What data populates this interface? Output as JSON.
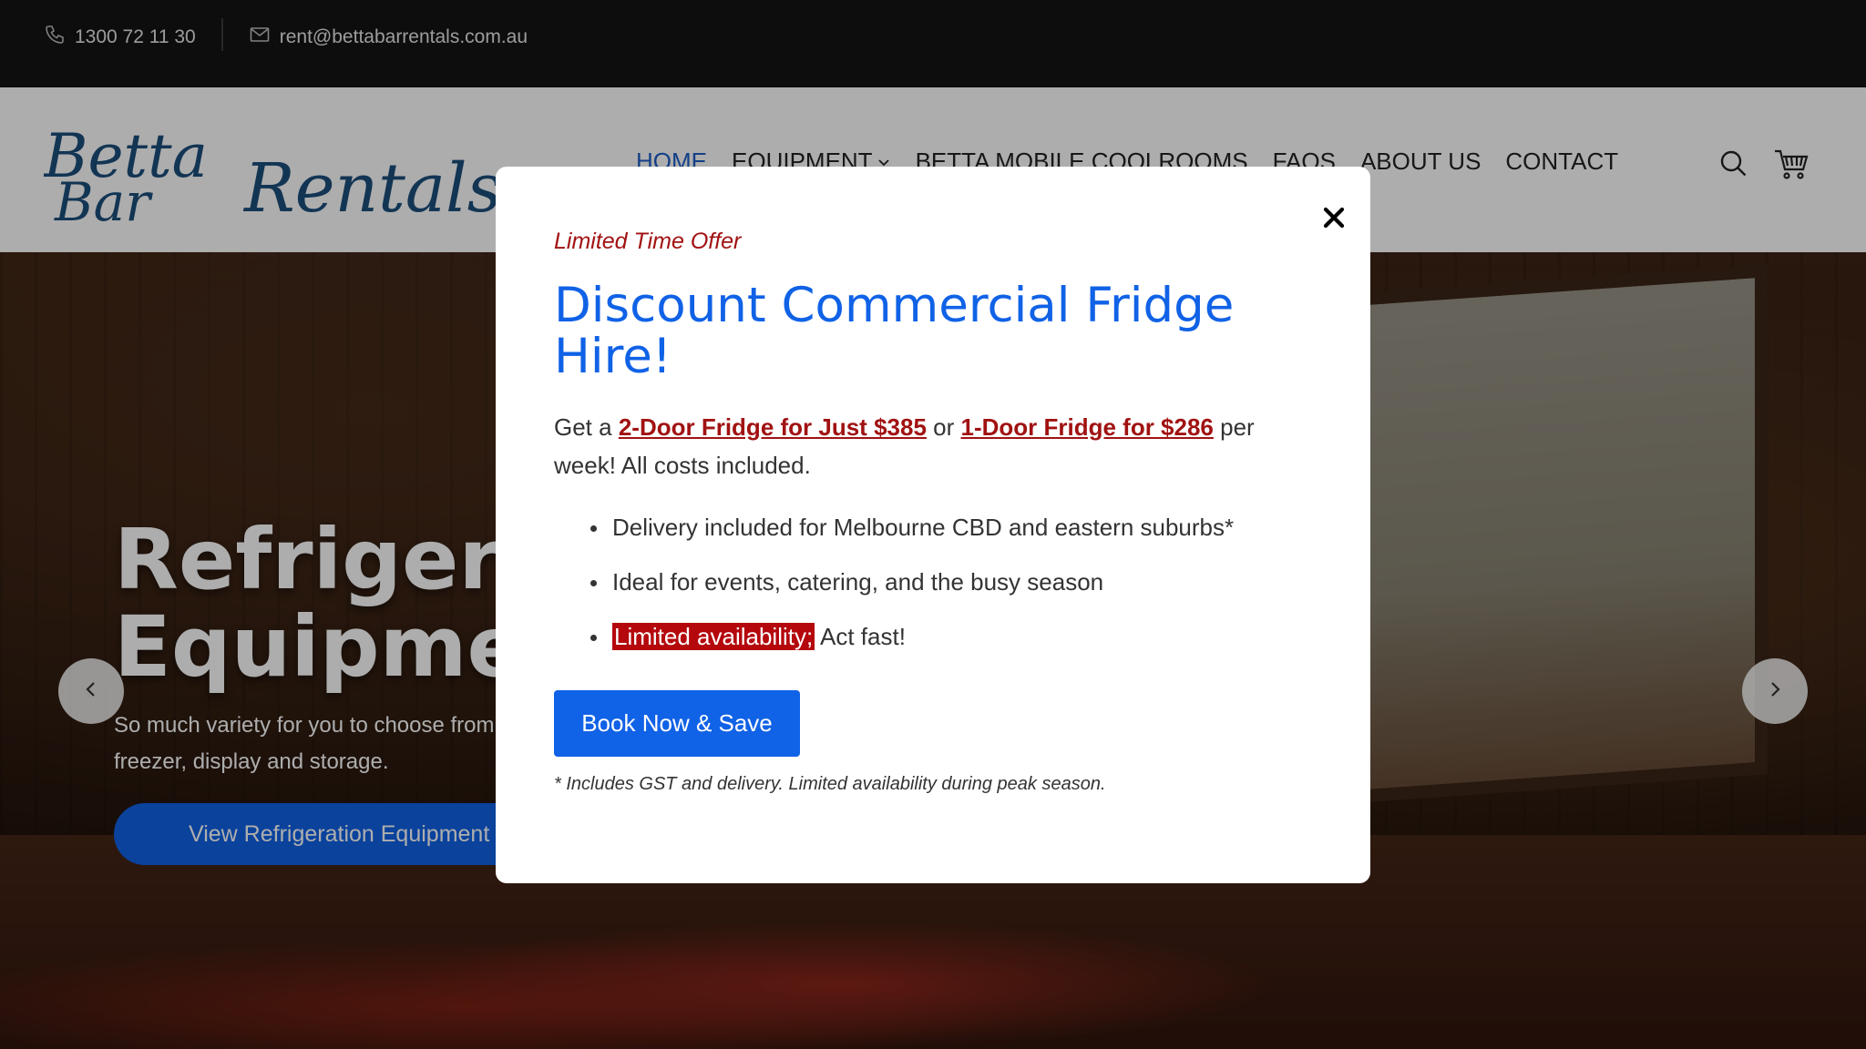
{
  "topbar": {
    "phone": "1300 72 11 30",
    "email": "rent@bettabarrentals.com.au"
  },
  "logo": {
    "line1": "Betta",
    "line2": "Bar",
    "line3": "Rentals",
    "color": "#1c4f7c"
  },
  "nav": {
    "items": [
      {
        "label": "HOME"
      },
      {
        "label": "EQUIPMENT"
      },
      {
        "label": "BETTA MOBILE COOLROOMS"
      },
      {
        "label": "FAQS"
      },
      {
        "label": "ABOUT US"
      },
      {
        "label": "CONTACT"
      }
    ],
    "active_color": "#1c5fc9"
  },
  "hero": {
    "title": "Refrigeration Equipment",
    "text": "So much variety for you to choose from, fridge, freezer, display and storage.",
    "button": "View Refrigeration Equipment"
  },
  "modal": {
    "kicker": "Limited Time Offer",
    "title": "Discount Commercial Fridge Hire!",
    "offer_prefix": "Get a",
    "offer_link1": "2-Door Fridge for Just $385",
    "offer_mid": "or",
    "offer_link2": "1-Door Fridge for $286",
    "offer_suffix": "per week! All costs included.",
    "bullets": [
      "Delivery included for Melbourne CBD and eastern suburbs*",
      "Ideal for events, catering, and the busy season"
    ],
    "bullet3_badge": "Limited availability;",
    "bullet3_rest": "Act fast!",
    "cta": "Book Now & Save",
    "footnote": "* Includes GST and delivery. Limited availability during peak season.",
    "accent": "#1062e6",
    "alert": "#a11212"
  }
}
